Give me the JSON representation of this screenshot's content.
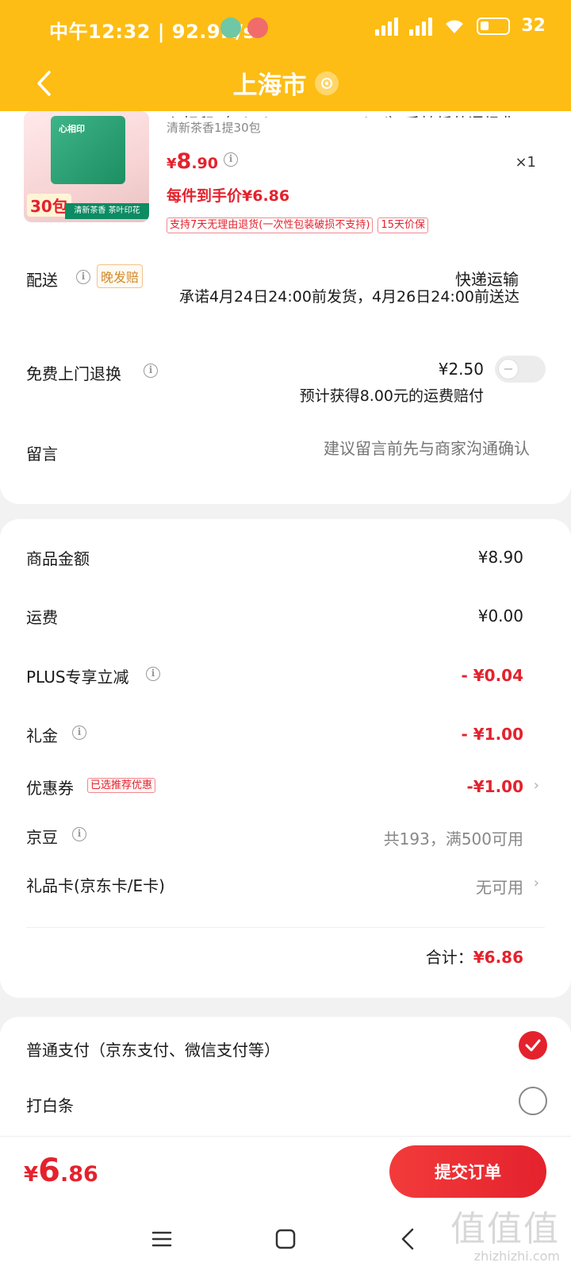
{
  "status_bar": {
    "time": "中午12:32",
    "speed": "92.9K/s",
    "battery": "32"
  },
  "nav": {
    "title": "上海市"
  },
  "product": {
    "name": "心相印（Mind Act Upon Mind）手帕纸茶语经典",
    "spec": "清新茶香1提30包",
    "price_yen": "¥",
    "price_int": "8",
    "price_dec": ".90",
    "quantity": "×1",
    "unit_price": "每件到手价¥6.86",
    "tags": [
      "支持7天无理由退货(一次性包装破损不支持)",
      "15天价保"
    ],
    "image": {
      "brand_text": "心相印",
      "count_tag": "30包",
      "strip_text": "清新茶香 茶叶印花"
    }
  },
  "delivery": {
    "label": "配送",
    "badge": "晚发赔",
    "method": "快递运输",
    "promise": "承诺4月24日24:00前发货，4月26日24:00前送达"
  },
  "free_return": {
    "label": "免费上门退换",
    "price": "¥2.50",
    "sub": "预计获得8.00元的运费赔付",
    "enabled": false
  },
  "message": {
    "label": "留言",
    "placeholder": "建议留言前先与商家沟通确认"
  },
  "fees": {
    "goods": {
      "label": "商品金额",
      "value": "¥8.90"
    },
    "shipping": {
      "label": "运费",
      "value": "¥0.00"
    },
    "plus": {
      "label": "PLUS专享立减",
      "value": "- ¥0.04"
    },
    "gift_money": {
      "label": "礼金",
      "value": "- ¥1.00"
    },
    "coupon": {
      "label": "优惠券",
      "tag": "已选推荐优惠",
      "value": "-¥1.00"
    },
    "jd_beans": {
      "label": "京豆",
      "value": "共193，满500可用"
    },
    "gift_card": {
      "label": "礼品卡(京东卡/E卡)",
      "value": "无可用"
    },
    "total_label": "合计：",
    "total_value": "¥6.86"
  },
  "payment": {
    "options": [
      {
        "label": "普通支付（京东支付、微信支付等）",
        "selected": true
      },
      {
        "label": "打白条",
        "selected": false
      }
    ]
  },
  "bottom": {
    "total_yen": "¥",
    "total_int": "6",
    "total_dec": ".86",
    "submit_label": "提交订单"
  },
  "watermark": {
    "big": "值值值",
    "small": "zhizhizhi.com"
  },
  "colors": {
    "brand_yellow": "#fdbd14",
    "accent_red": "#e4222d"
  }
}
